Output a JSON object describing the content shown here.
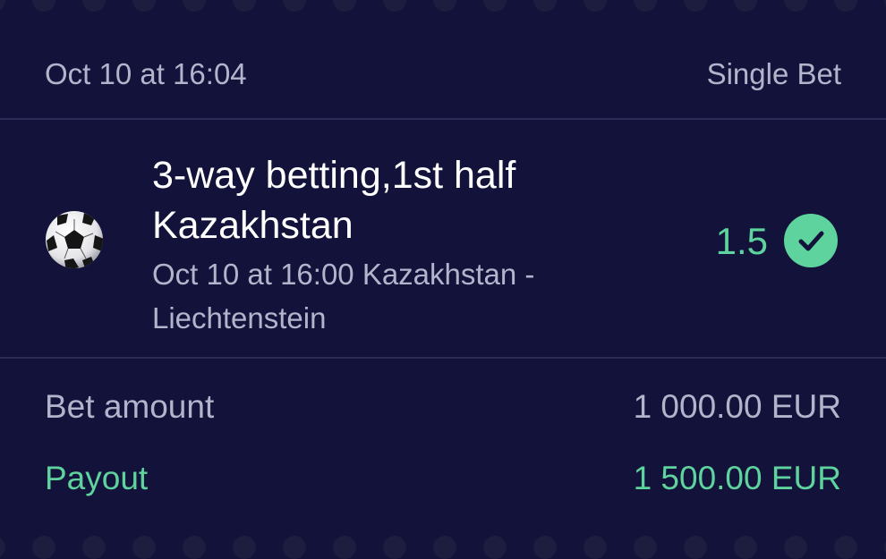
{
  "header": {
    "date": "Oct 10 at 16:04",
    "bet_type": "Single Bet"
  },
  "selection": {
    "sport_icon": "soccer-ball-icon",
    "market": "3-way betting,1st half",
    "pick": "Kazakhstan",
    "event_line1": "Oct 10 at 16:00 Kazakhstan -",
    "event_line2": "Liechtenstein",
    "odds": "1.5",
    "status_icon": "check-circle-icon"
  },
  "totals": {
    "bet_amount_label": "Bet amount",
    "bet_amount_value": "1 000.00 EUR",
    "payout_label": "Payout",
    "payout_value": "1 500.00 EUR"
  },
  "colors": {
    "background": "#12123a",
    "divider": "#2b2c57",
    "muted_text": "#b3b4cc",
    "primary_text": "#ffffff",
    "accent_green": "#5ed39d"
  }
}
